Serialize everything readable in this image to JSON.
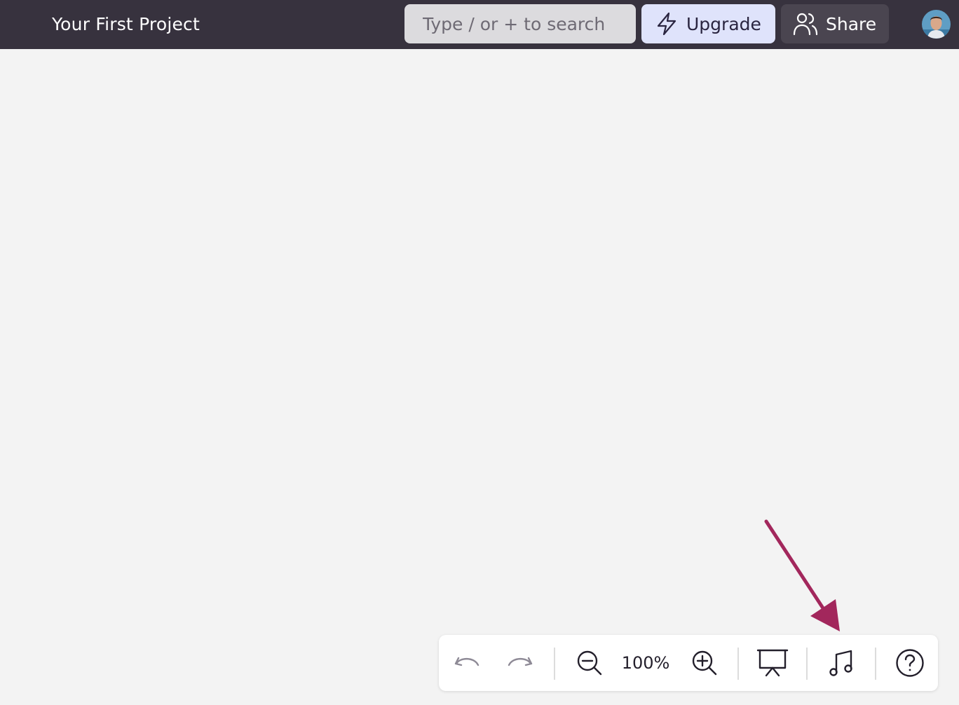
{
  "header": {
    "project_title": "Your First Project",
    "search_placeholder": "Type / or + to search",
    "upgrade_label": "Upgrade",
    "share_label": "Share"
  },
  "toolbar": {
    "zoom_level": "100%",
    "items": [
      "undo",
      "redo",
      "zoom-out",
      "zoom-in",
      "present",
      "music",
      "help"
    ]
  },
  "icons": {
    "upgrade": "lightning-icon",
    "share": "users-icon",
    "undo": "undo-icon",
    "redo": "redo-icon",
    "zoom_out": "zoom-out-icon",
    "zoom_in": "zoom-in-icon",
    "present": "presentation-icon",
    "music": "music-note-icon",
    "help": "help-icon"
  },
  "colors": {
    "topbar": "#37323e",
    "canvas": "#f3f3f3",
    "upgrade_bg": "#dfe3fb",
    "share_bg": "#4a4550",
    "arrow": "#a2275c"
  }
}
